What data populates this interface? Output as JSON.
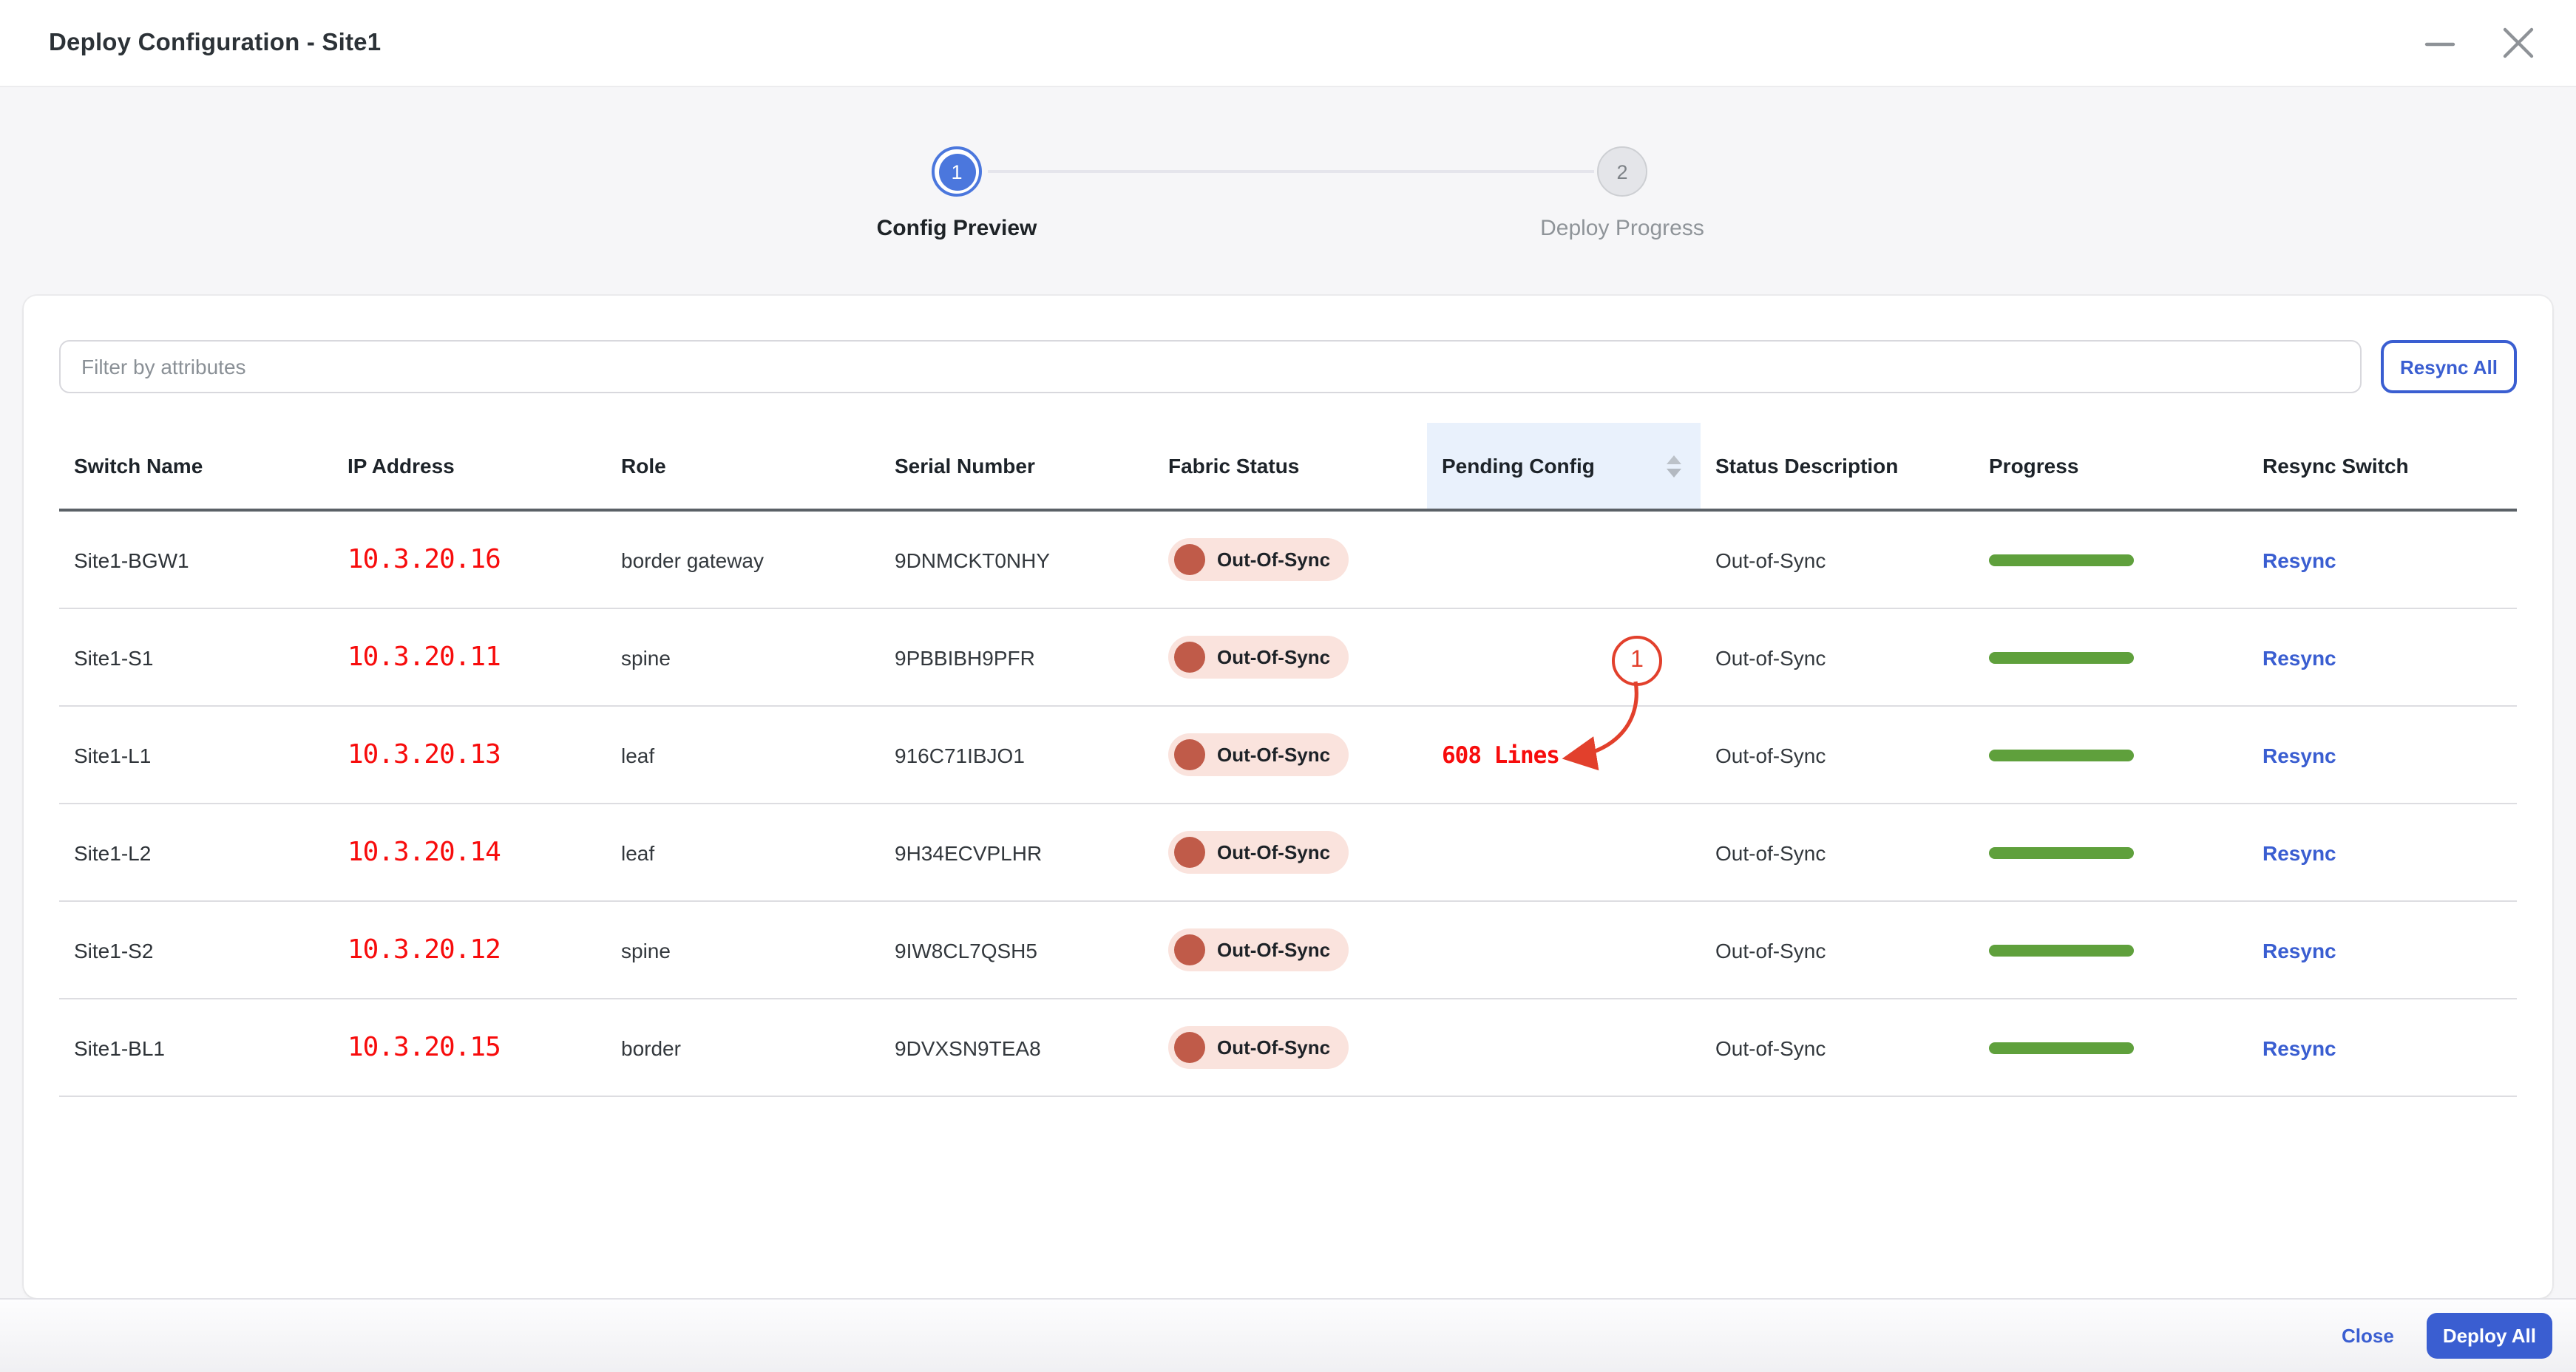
{
  "window": {
    "title": "Deploy Configuration - Site1"
  },
  "stepper": {
    "steps": [
      {
        "number": "1",
        "label": "Config Preview",
        "active": true
      },
      {
        "number": "2",
        "label": "Deploy Progress",
        "active": false
      }
    ]
  },
  "toolbar": {
    "filter_placeholder": "Filter by attributes",
    "resync_all_label": "Resync All"
  },
  "table": {
    "columns": [
      "Switch Name",
      "IP Address",
      "Role",
      "Serial Number",
      "Fabric Status",
      "Pending Config",
      "Status Description",
      "Progress",
      "Resync Switch"
    ],
    "sorted_column": "Pending Config",
    "rows": [
      {
        "switch_name": "Site1-BGW1",
        "ip": "10.3.20.16",
        "role": "border gateway",
        "serial": "9DNMCKT0NHY",
        "fabric_status": "Out-Of-Sync",
        "pending_config": "",
        "status_description": "Out-of-Sync",
        "progress_percent": 100,
        "resync_label": "Resync"
      },
      {
        "switch_name": "Site1-S1",
        "ip": "10.3.20.11",
        "role": "spine",
        "serial": "9PBBIBH9PFR",
        "fabric_status": "Out-Of-Sync",
        "pending_config": "",
        "status_description": "Out-of-Sync",
        "progress_percent": 100,
        "resync_label": "Resync"
      },
      {
        "switch_name": "Site1-L1",
        "ip": "10.3.20.13",
        "role": "leaf",
        "serial": "916C71IBJO1",
        "fabric_status": "Out-Of-Sync",
        "pending_config": "608 Lines",
        "status_description": "Out-of-Sync",
        "progress_percent": 100,
        "resync_label": "Resync"
      },
      {
        "switch_name": "Site1-L2",
        "ip": "10.3.20.14",
        "role": "leaf",
        "serial": "9H34ECVPLHR",
        "fabric_status": "Out-Of-Sync",
        "pending_config": "",
        "status_description": "Out-of-Sync",
        "progress_percent": 100,
        "resync_label": "Resync"
      },
      {
        "switch_name": "Site1-S2",
        "ip": "10.3.20.12",
        "role": "spine",
        "serial": "9IW8CL7QSH5",
        "fabric_status": "Out-Of-Sync",
        "pending_config": "",
        "status_description": "Out-of-Sync",
        "progress_percent": 100,
        "resync_label": "Resync"
      },
      {
        "switch_name": "Site1-BL1",
        "ip": "10.3.20.15",
        "role": "border",
        "serial": "9DVXSN9TEA8",
        "fabric_status": "Out-Of-Sync",
        "pending_config": "",
        "status_description": "Out-of-Sync",
        "progress_percent": 100,
        "resync_label": "Resync"
      }
    ]
  },
  "annotation": {
    "callout_number": "1",
    "points_to": "608 Lines"
  },
  "footer": {
    "close_label": "Close",
    "deploy_all_label": "Deploy All"
  },
  "colors": {
    "accent_blue": "#3a5ed1",
    "stepper_blue": "#4b77dd",
    "alert_red": "#f70c0c",
    "annotation_red": "#e2402c",
    "progress_green": "#5fa03c",
    "badge_bg": "#fae3dd",
    "badge_dot": "#c05b49",
    "header_highlight": "#e9f1fc",
    "page_bg": "#f6f6f8"
  }
}
